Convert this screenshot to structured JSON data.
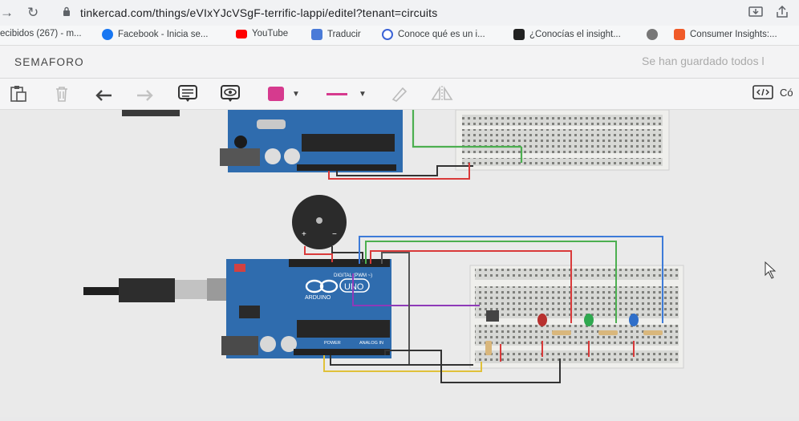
{
  "browser": {
    "url": "tinkercad.com/things/eVIxYJcVSgF-terrific-lappi/editel?tenant=circuits",
    "bookmarks": [
      {
        "label": "ecibidos (267) - m...",
        "icon": "mail-icon",
        "color": "#777777"
      },
      {
        "label": "Facebook - Inicia se...",
        "icon": "facebook-icon",
        "color": "#1877f2"
      },
      {
        "label": "YouTube",
        "icon": "youtube-icon",
        "color": "#ff0000"
      },
      {
        "label": "Traducir",
        "icon": "translate-icon",
        "color": "#4a7bd8"
      },
      {
        "label": "Conoce qué es un i...",
        "icon": "doc-icon",
        "color": "#3b63d6"
      },
      {
        "label": "¿Conocías el insight...",
        "icon": "bars-icon",
        "color": "#222222"
      },
      {
        "label": "",
        "icon": "globe-icon",
        "color": "#666666"
      },
      {
        "label": "Consumer Insights:...",
        "icon": "blogger-icon",
        "color": "#f05a28"
      }
    ]
  },
  "app": {
    "title": "SEMAFORO",
    "save_status": "Se han guardado todos l",
    "code_label": "Có"
  },
  "toolbar": {
    "fill_color": "#d63a8e",
    "line_color": "#d63a8e"
  },
  "circuit": {
    "board_label_top": "DIGITAL (PWM ~)",
    "board_brand": "ARDUINO",
    "board_model": "UNO",
    "power_label": "POWER",
    "analog_label": "ANALOG IN",
    "led_colors": [
      "#b8312f",
      "#2fa84f",
      "#2f6fc9"
    ],
    "wire_colors": {
      "red": "#d93a3a",
      "green": "#4caf50",
      "blue": "#3d7bd9",
      "purple": "#8e3ab8",
      "gray": "#555555",
      "yellow": "#e0c13a"
    }
  }
}
